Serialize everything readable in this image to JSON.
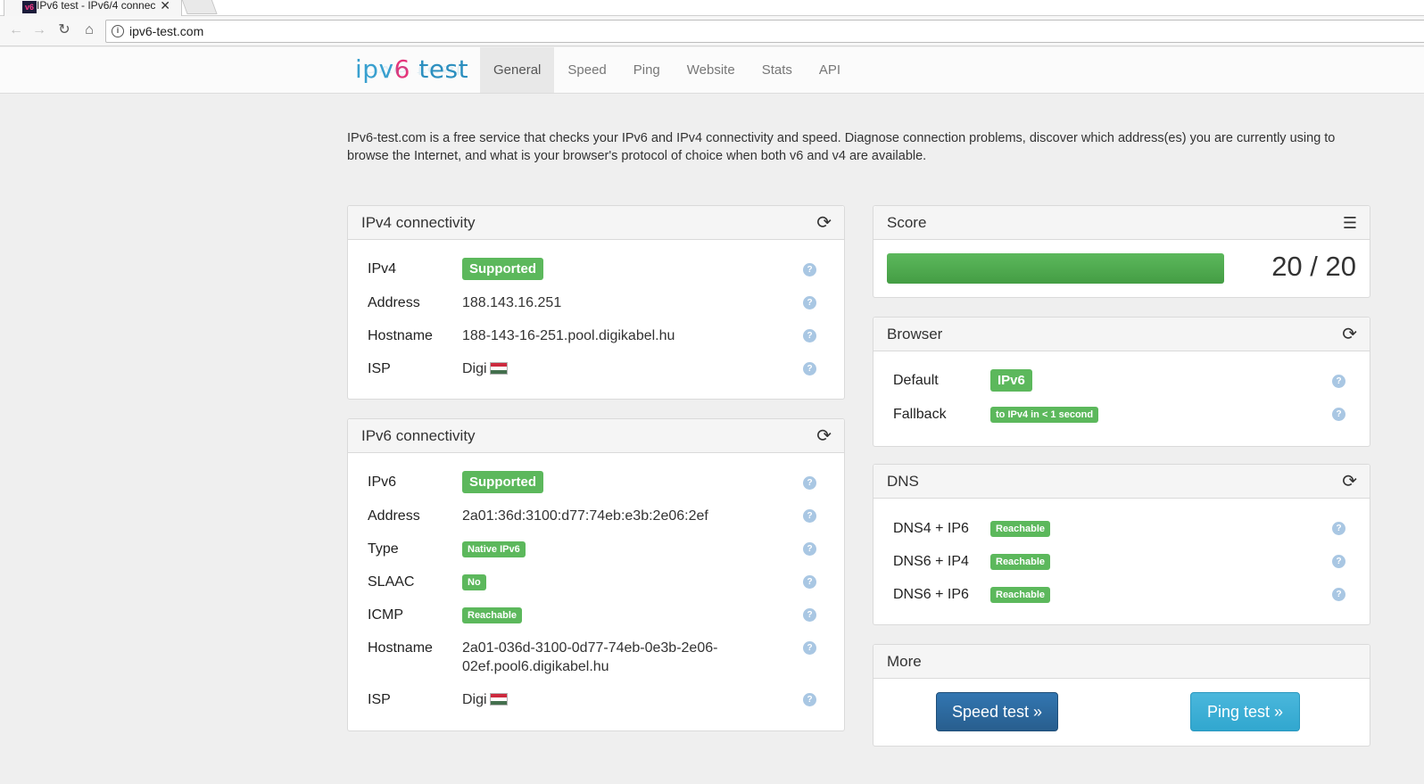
{
  "browser": {
    "tab_title": "IPv6 test - IPv6/4 connec",
    "favicon_text": "v6",
    "url": "ipv6-test.com"
  },
  "site": {
    "logo_ipv": "ipv",
    "logo_six": "6",
    "logo_test": " test",
    "nav": [
      "General",
      "Speed",
      "Ping",
      "Website",
      "Stats",
      "API"
    ],
    "active_nav": "General"
  },
  "intro": "IPv6-test.com is a free service that checks your IPv6 and IPv4 connectivity and speed. Diagnose connection problems, discover which address(es) you are currently using to browse the Internet, and what is your browser's protocol of choice when both v6 and v4 are available.",
  "ipv4": {
    "title": "IPv4 connectivity",
    "rows": [
      {
        "label": "IPv4",
        "value": "Supported"
      },
      {
        "label": "Address",
        "value": "188.143.16.251"
      },
      {
        "label": "Hostname",
        "value": "188-143-16-251.pool.digikabel.hu"
      },
      {
        "label": "ISP",
        "value": "Digi"
      }
    ]
  },
  "ipv6": {
    "title": "IPv6 connectivity",
    "rows": [
      {
        "label": "IPv6",
        "value": "Supported"
      },
      {
        "label": "Address",
        "value": "2a01:36d:3100:d77:74eb:e3b:2e06:2ef"
      },
      {
        "label": "Type",
        "value": "Native IPv6"
      },
      {
        "label": "SLAAC",
        "value": "No"
      },
      {
        "label": "ICMP",
        "value": "Reachable"
      },
      {
        "label": "Hostname",
        "value": "2a01-036d-3100-0d77-74eb-0e3b-2e06-",
        "value2": "02ef.pool6.digikabel.hu"
      },
      {
        "label": "ISP",
        "value": "Digi"
      }
    ]
  },
  "score": {
    "title": "Score",
    "text": "20 / 20",
    "fraction": 1.0
  },
  "browser_panel": {
    "title": "Browser",
    "rows": [
      {
        "label": "Default",
        "value": "IPv6"
      },
      {
        "label": "Fallback",
        "value": "to IPv4 in < 1 second"
      }
    ]
  },
  "dns": {
    "title": "DNS",
    "rows": [
      {
        "label": "DNS4 + IP6",
        "value": "Reachable"
      },
      {
        "label": "DNS6 + IP4",
        "value": "Reachable"
      },
      {
        "label": "DNS6 + IP6",
        "value": "Reachable"
      }
    ]
  },
  "more": {
    "title": "More",
    "speed_test": "Speed test »",
    "ping_test": "Ping test »"
  },
  "colors": {
    "success": "#5cb85c",
    "link": "#3a83c1",
    "primary": "#3276b1",
    "info": "#39b3d7"
  },
  "icons": {
    "refresh": "refresh-icon",
    "list": "list-icon",
    "help": "help-icon",
    "flag": "hungary-flag-icon"
  }
}
